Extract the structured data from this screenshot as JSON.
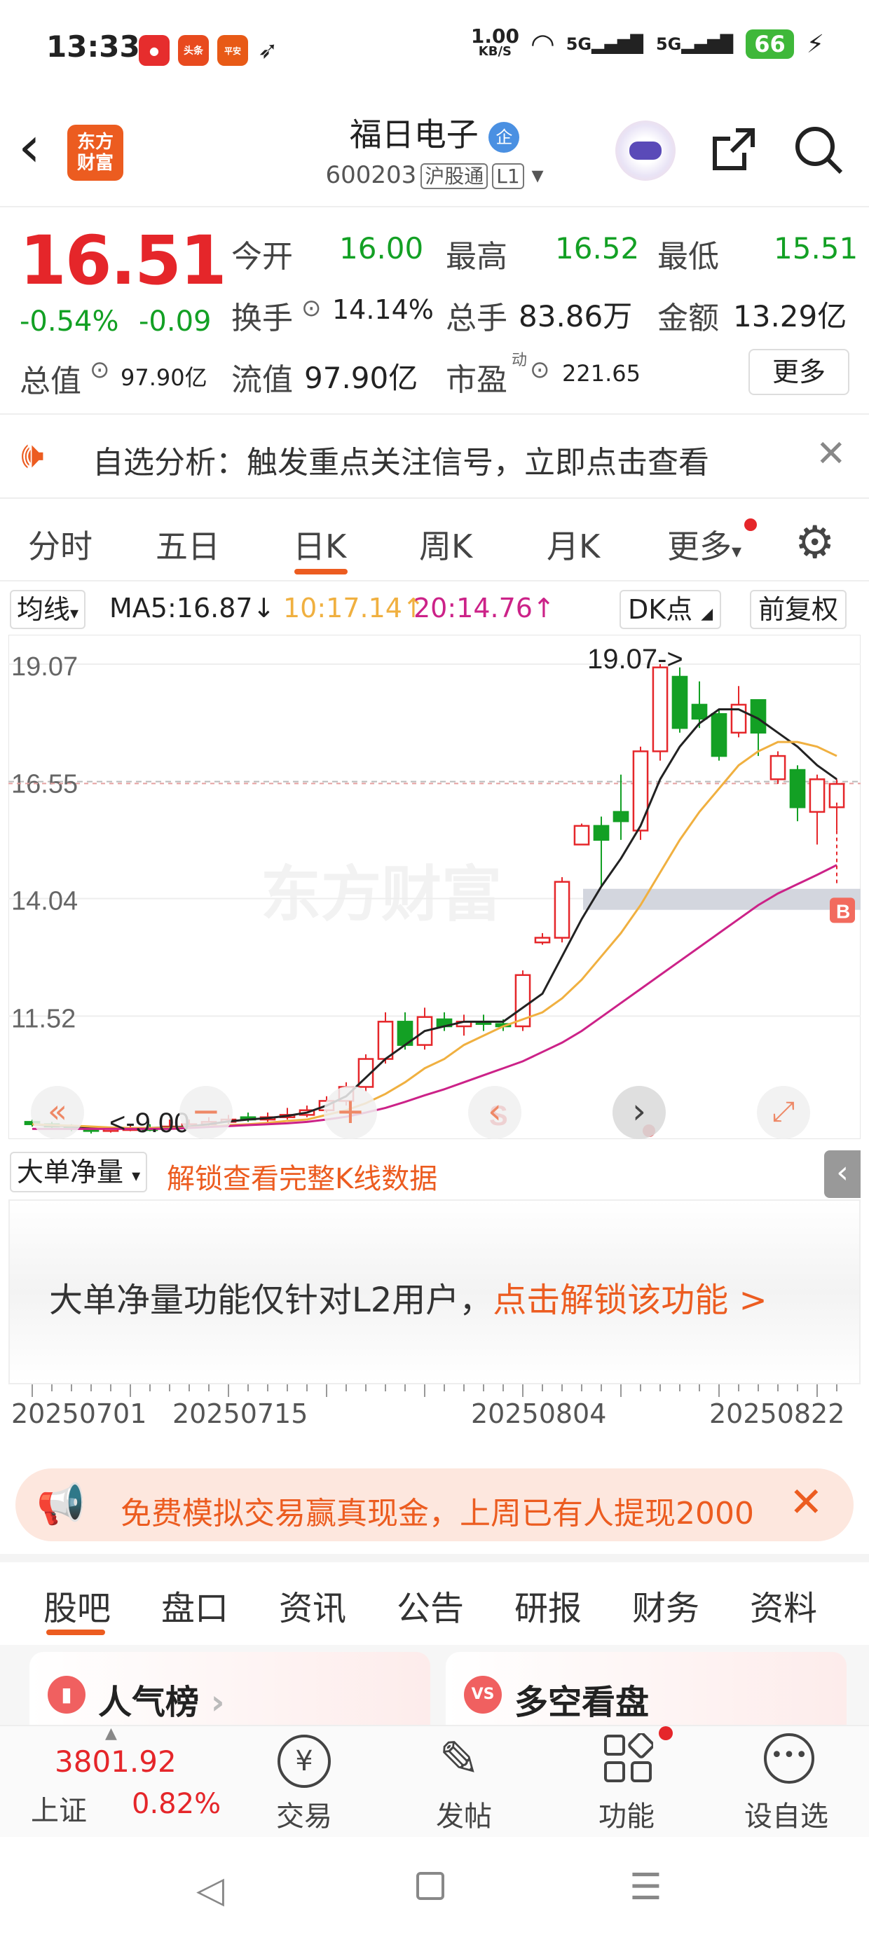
{
  "status": {
    "time": "13:33",
    "net_speed": "1.00",
    "net_unit": "KB/S",
    "sig1": "5G",
    "sig2": "5G",
    "battery": "66"
  },
  "header": {
    "back": "‹",
    "logo_l1": "东方",
    "logo_l2": "财富",
    "title": "福日电子",
    "badge": "企",
    "code": "600203",
    "tag1": "沪股通",
    "tag2": "L1"
  },
  "quote": {
    "price": "16.51",
    "pct": "-0.54%",
    "chg": "-0.09",
    "open_l": "今开",
    "open_v": "16.00",
    "high_l": "最高",
    "high_v": "16.52",
    "low_l": "最低",
    "low_v": "15.51",
    "turn_l": "换手",
    "turn_v": "14.14%",
    "vol_l": "总手",
    "vol_v": "83.86万",
    "amt_l": "金额",
    "amt_v": "13.29亿",
    "mcap_l": "总值",
    "mcap_v": "97.90亿",
    "float_l": "流值",
    "float_v": "97.90亿",
    "pe_l": "市盈",
    "pe_sup": "动",
    "pe_v": "221.65",
    "more": "更多"
  },
  "notice": {
    "text": "自选分析：触发重点关注信号，立即点击查看"
  },
  "tabs": [
    "分时",
    "五日",
    "日K",
    "周K",
    "月K",
    "更多"
  ],
  "ma": {
    "sel": "均线",
    "ma5": "MA5:16.87↓",
    "ma10": "10:17.14↑",
    "ma20": "20:14.76↑",
    "dk": "DK点",
    "fq": "前复权"
  },
  "chart_data": {
    "type": "candlestick",
    "ylim": [
      9.0,
      19.07
    ],
    "y_ticks": [
      "19.07",
      "16.55",
      "14.04",
      "11.52"
    ],
    "max_label": "19.07->",
    "min_label": "<-9.00",
    "x_labels": [
      "20250701",
      "20250715",
      "20250804",
      "20250822"
    ],
    "mark_b": "B",
    "mark_s": "S",
    "candles": [
      [
        9.25,
        9.2,
        9.3,
        9.15
      ],
      [
        9.2,
        9.15,
        9.25,
        9.1
      ],
      [
        9.15,
        9.1,
        9.2,
        9.05
      ],
      [
        9.1,
        9.08,
        9.15,
        9.0
      ],
      [
        9.08,
        9.1,
        9.15,
        9.02
      ],
      [
        9.1,
        9.12,
        9.18,
        9.05
      ],
      [
        9.12,
        9.1,
        9.2,
        9.05
      ],
      [
        9.1,
        9.15,
        9.3,
        9.05
      ],
      [
        9.15,
        9.2,
        9.3,
        9.1
      ],
      [
        9.2,
        9.25,
        9.35,
        9.15
      ],
      [
        9.25,
        9.3,
        9.4,
        9.2
      ],
      [
        9.35,
        9.3,
        9.45,
        9.25
      ],
      [
        9.3,
        9.35,
        9.45,
        9.25
      ],
      [
        9.35,
        9.4,
        9.55,
        9.3
      ],
      [
        9.4,
        9.5,
        9.6,
        9.35
      ],
      [
        9.5,
        9.7,
        9.8,
        9.45
      ],
      [
        9.7,
        10.0,
        10.1,
        9.6
      ],
      [
        10.0,
        10.6,
        10.7,
        9.9
      ],
      [
        10.6,
        11.4,
        11.6,
        10.5
      ],
      [
        11.4,
        10.9,
        11.6,
        10.8
      ],
      [
        10.9,
        11.5,
        11.7,
        10.8
      ],
      [
        11.45,
        11.3,
        11.6,
        11.2
      ],
      [
        11.3,
        11.4,
        11.55,
        11.1
      ],
      [
        11.4,
        11.35,
        11.55,
        11.2
      ],
      [
        11.35,
        11.3,
        11.45,
        11.2
      ],
      [
        11.3,
        12.4,
        12.5,
        11.2
      ],
      [
        13.1,
        13.2,
        13.3,
        13.05
      ],
      [
        13.2,
        14.4,
        14.5,
        13.1
      ],
      [
        15.2,
        15.6,
        15.65,
        15.2
      ],
      [
        15.6,
        15.3,
        15.8,
        14.3
      ],
      [
        15.9,
        15.7,
        16.7,
        15.3
      ],
      [
        15.5,
        17.2,
        17.3,
        15.3
      ],
      [
        17.2,
        19.0,
        19.07,
        17.0
      ],
      [
        18.8,
        17.7,
        19.0,
        17.6
      ],
      [
        18.2,
        17.9,
        18.7,
        17.7
      ],
      [
        18.0,
        17.1,
        18.1,
        17.0
      ],
      [
        17.6,
        18.2,
        18.6,
        17.5
      ],
      [
        18.3,
        17.6,
        18.0,
        17.1
      ],
      [
        16.6,
        17.1,
        17.2,
        16.5
      ],
      [
        16.8,
        16.0,
        16.9,
        15.7
      ],
      [
        15.9,
        16.6,
        16.7,
        15.2
      ],
      [
        16.0,
        16.5,
        16.6,
        15.5
      ]
    ],
    "ma5": [
      9.2,
      9.17,
      9.16,
      9.13,
      9.11,
      9.11,
      9.12,
      9.13,
      9.15,
      9.2,
      9.26,
      9.3,
      9.33,
      9.38,
      9.45,
      9.6,
      9.8,
      10.2,
      10.6,
      10.9,
      11.2,
      11.3,
      11.4,
      11.4,
      11.4,
      11.7,
      12.0,
      12.8,
      13.6,
      14.3,
      14.9,
      15.6,
      16.6,
      17.3,
      17.8,
      18.1,
      18.1,
      17.9,
      17.6,
      17.3,
      16.9,
      16.6
    ],
    "ma10": [
      9.2,
      9.18,
      9.17,
      9.15,
      9.13,
      9.12,
      9.12,
      9.12,
      9.13,
      9.15,
      9.18,
      9.2,
      9.23,
      9.27,
      9.3,
      9.4,
      9.5,
      9.65,
      9.85,
      10.1,
      10.4,
      10.6,
      10.9,
      11.1,
      11.3,
      11.45,
      11.6,
      11.9,
      12.3,
      12.8,
      13.3,
      13.9,
      14.6,
      15.3,
      15.9,
      16.4,
      16.9,
      17.2,
      17.4,
      17.4,
      17.3,
      17.1
    ],
    "ma20": [
      9.1,
      9.1,
      9.1,
      9.1,
      9.1,
      9.1,
      9.1,
      9.1,
      9.12,
      9.14,
      9.16,
      9.18,
      9.2,
      9.22,
      9.25,
      9.3,
      9.36,
      9.45,
      9.55,
      9.68,
      9.82,
      9.95,
      10.1,
      10.25,
      10.4,
      10.55,
      10.75,
      10.95,
      11.2,
      11.5,
      11.8,
      12.1,
      12.4,
      12.7,
      13.0,
      13.3,
      13.6,
      13.9,
      14.15,
      14.35,
      14.55,
      14.76
    ],
    "colors": {
      "up": "#e5262a",
      "down": "#13a024",
      "ma5": "#222222",
      "ma10": "#f0b040",
      "ma20": "#cc2288"
    }
  },
  "sub": {
    "sel": "大单净量",
    "unlock": "解锁查看完整K线数据",
    "msg1": "大单净量功能仅针对L2用户，",
    "msg2": "点击解锁该功能 >"
  },
  "ad": {
    "text": "免费模拟交易赢真现金，上周已有人提现2000"
  },
  "subtabs": [
    "股吧",
    "盘口",
    "资讯",
    "公告",
    "研报",
    "财务",
    "资料"
  ],
  "cards": {
    "c1": "人气榜",
    "c2": "多空看盘",
    "vs": "VS"
  },
  "bottom": {
    "index_v": "3801.92",
    "index_n": "上证",
    "index_p": "0.82%",
    "trade": "交易",
    "post": "发帖",
    "func": "功能",
    "fav": "设自选"
  }
}
